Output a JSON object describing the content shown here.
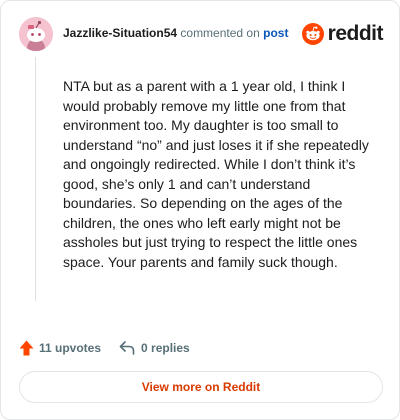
{
  "comment": {
    "author": "Jazzlike-Situation54",
    "action_text": "commented on",
    "post_link_label": "post",
    "body": "NTA but as a parent with a 1 year old, I think I would probably remove my little one from that environment too. My daughter is too small to understand “no” and just loses it if she repeatedly and ongoingly redirected. While I don’t think it’s good, she’s only 1 and can’t understand boundaries. So depending on the ages of the children, the ones who left early might not be assholes but just trying to respect the little ones space. Your parents and family suck though.",
    "upvotes_label": "11 upvotes",
    "replies_label": "0 replies"
  },
  "brand": {
    "logo_text": "reddit",
    "logo_icon": "reddit-snoo-icon",
    "accent_color": "#ff4500",
    "upvote_color": "#ff4500",
    "link_color": "#0a55b8",
    "cta_color": "#d93a00"
  },
  "actions": {
    "view_more_label": "View more on Reddit"
  },
  "icons": {
    "avatar": "snoo-avatar-icon",
    "upvote": "upvote-arrow-icon",
    "reply": "reply-arrow-icon"
  }
}
